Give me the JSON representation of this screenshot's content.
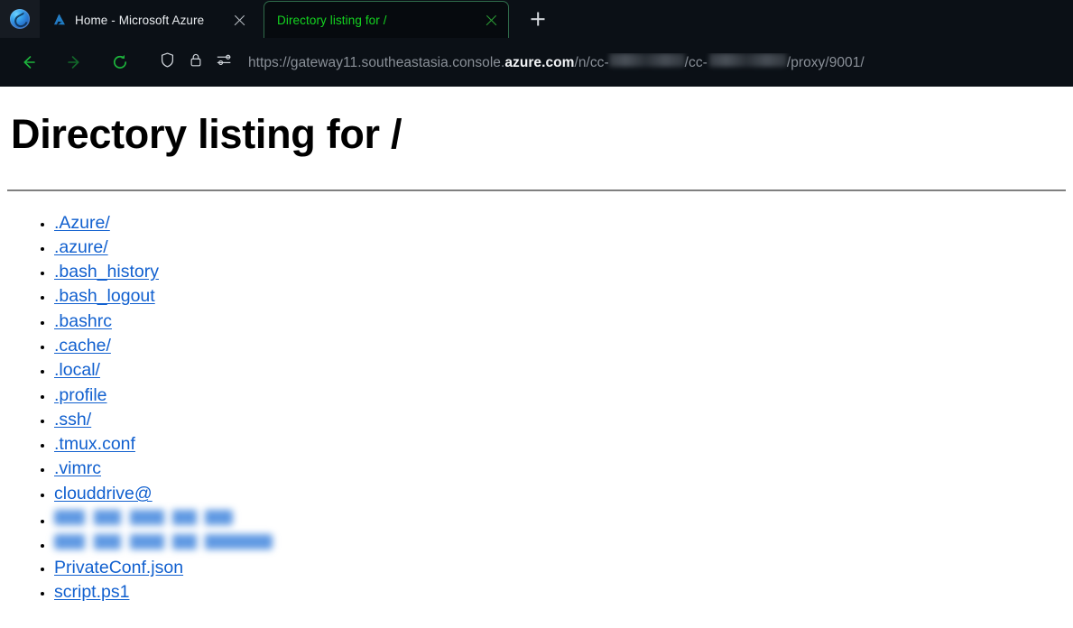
{
  "browser": {
    "app_button_icon": "firefox-logo",
    "tabs": [
      {
        "favicon": "azure-logo-icon",
        "title": "Home - Microsoft Azure",
        "active": false,
        "close_icon": "close-icon"
      },
      {
        "favicon": "none",
        "title": "Directory listing for /",
        "active": true,
        "close_icon": "close-icon"
      }
    ],
    "new_tab_label": "+",
    "nav": {
      "back_icon": "back-arrow-icon",
      "forward_icon": "forward-arrow-icon",
      "reload_icon": "reload-icon"
    },
    "urlbar": {
      "shield_icon": "shield-icon",
      "lock_icon": "padlock-icon",
      "permissions_icon": "permissions-sliders-icon",
      "url_prefix": "https://gateway11.southeastasia.console.",
      "url_domain": "azure.com",
      "url_path_part1": "/n/cc-",
      "url_redacted_1": "[redacted]",
      "url_path_part2": "/cc-",
      "url_redacted_2": "[redacted]",
      "url_path_part3": "/proxy/9001/"
    }
  },
  "page": {
    "title": "Directory listing for /",
    "entries": [
      {
        "label": ".Azure/",
        "redacted": false
      },
      {
        "label": ".azure/",
        "redacted": false
      },
      {
        "label": ".bash_history",
        "redacted": false
      },
      {
        "label": ".bash_logout",
        "redacted": false
      },
      {
        "label": ".bashrc",
        "redacted": false
      },
      {
        "label": ".cache/",
        "redacted": false
      },
      {
        "label": ".local/",
        "redacted": false
      },
      {
        "label": ".profile",
        "redacted": false
      },
      {
        "label": ".ssh/",
        "redacted": false
      },
      {
        "label": ".tmux.conf",
        "redacted": false
      },
      {
        "label": ".vimrc",
        "redacted": false
      },
      {
        "label": "clouddrive@",
        "redacted": false
      },
      {
        "label": "",
        "redacted": true,
        "blob": "r1"
      },
      {
        "label": "",
        "redacted": true,
        "blob": "r2"
      },
      {
        "label": "PrivateConf.json",
        "redacted": false
      },
      {
        "label": "script.ps1",
        "redacted": false
      }
    ]
  },
  "colors": {
    "chrome_bg": "#0b1016",
    "active_tab_text": "#14d320",
    "active_tab_border": "#2f6b4a",
    "nav_icon_green": "#1db43c",
    "link_blue": "#1160cf",
    "page_bg": "#ffffff",
    "rule_gray": "#808080"
  }
}
